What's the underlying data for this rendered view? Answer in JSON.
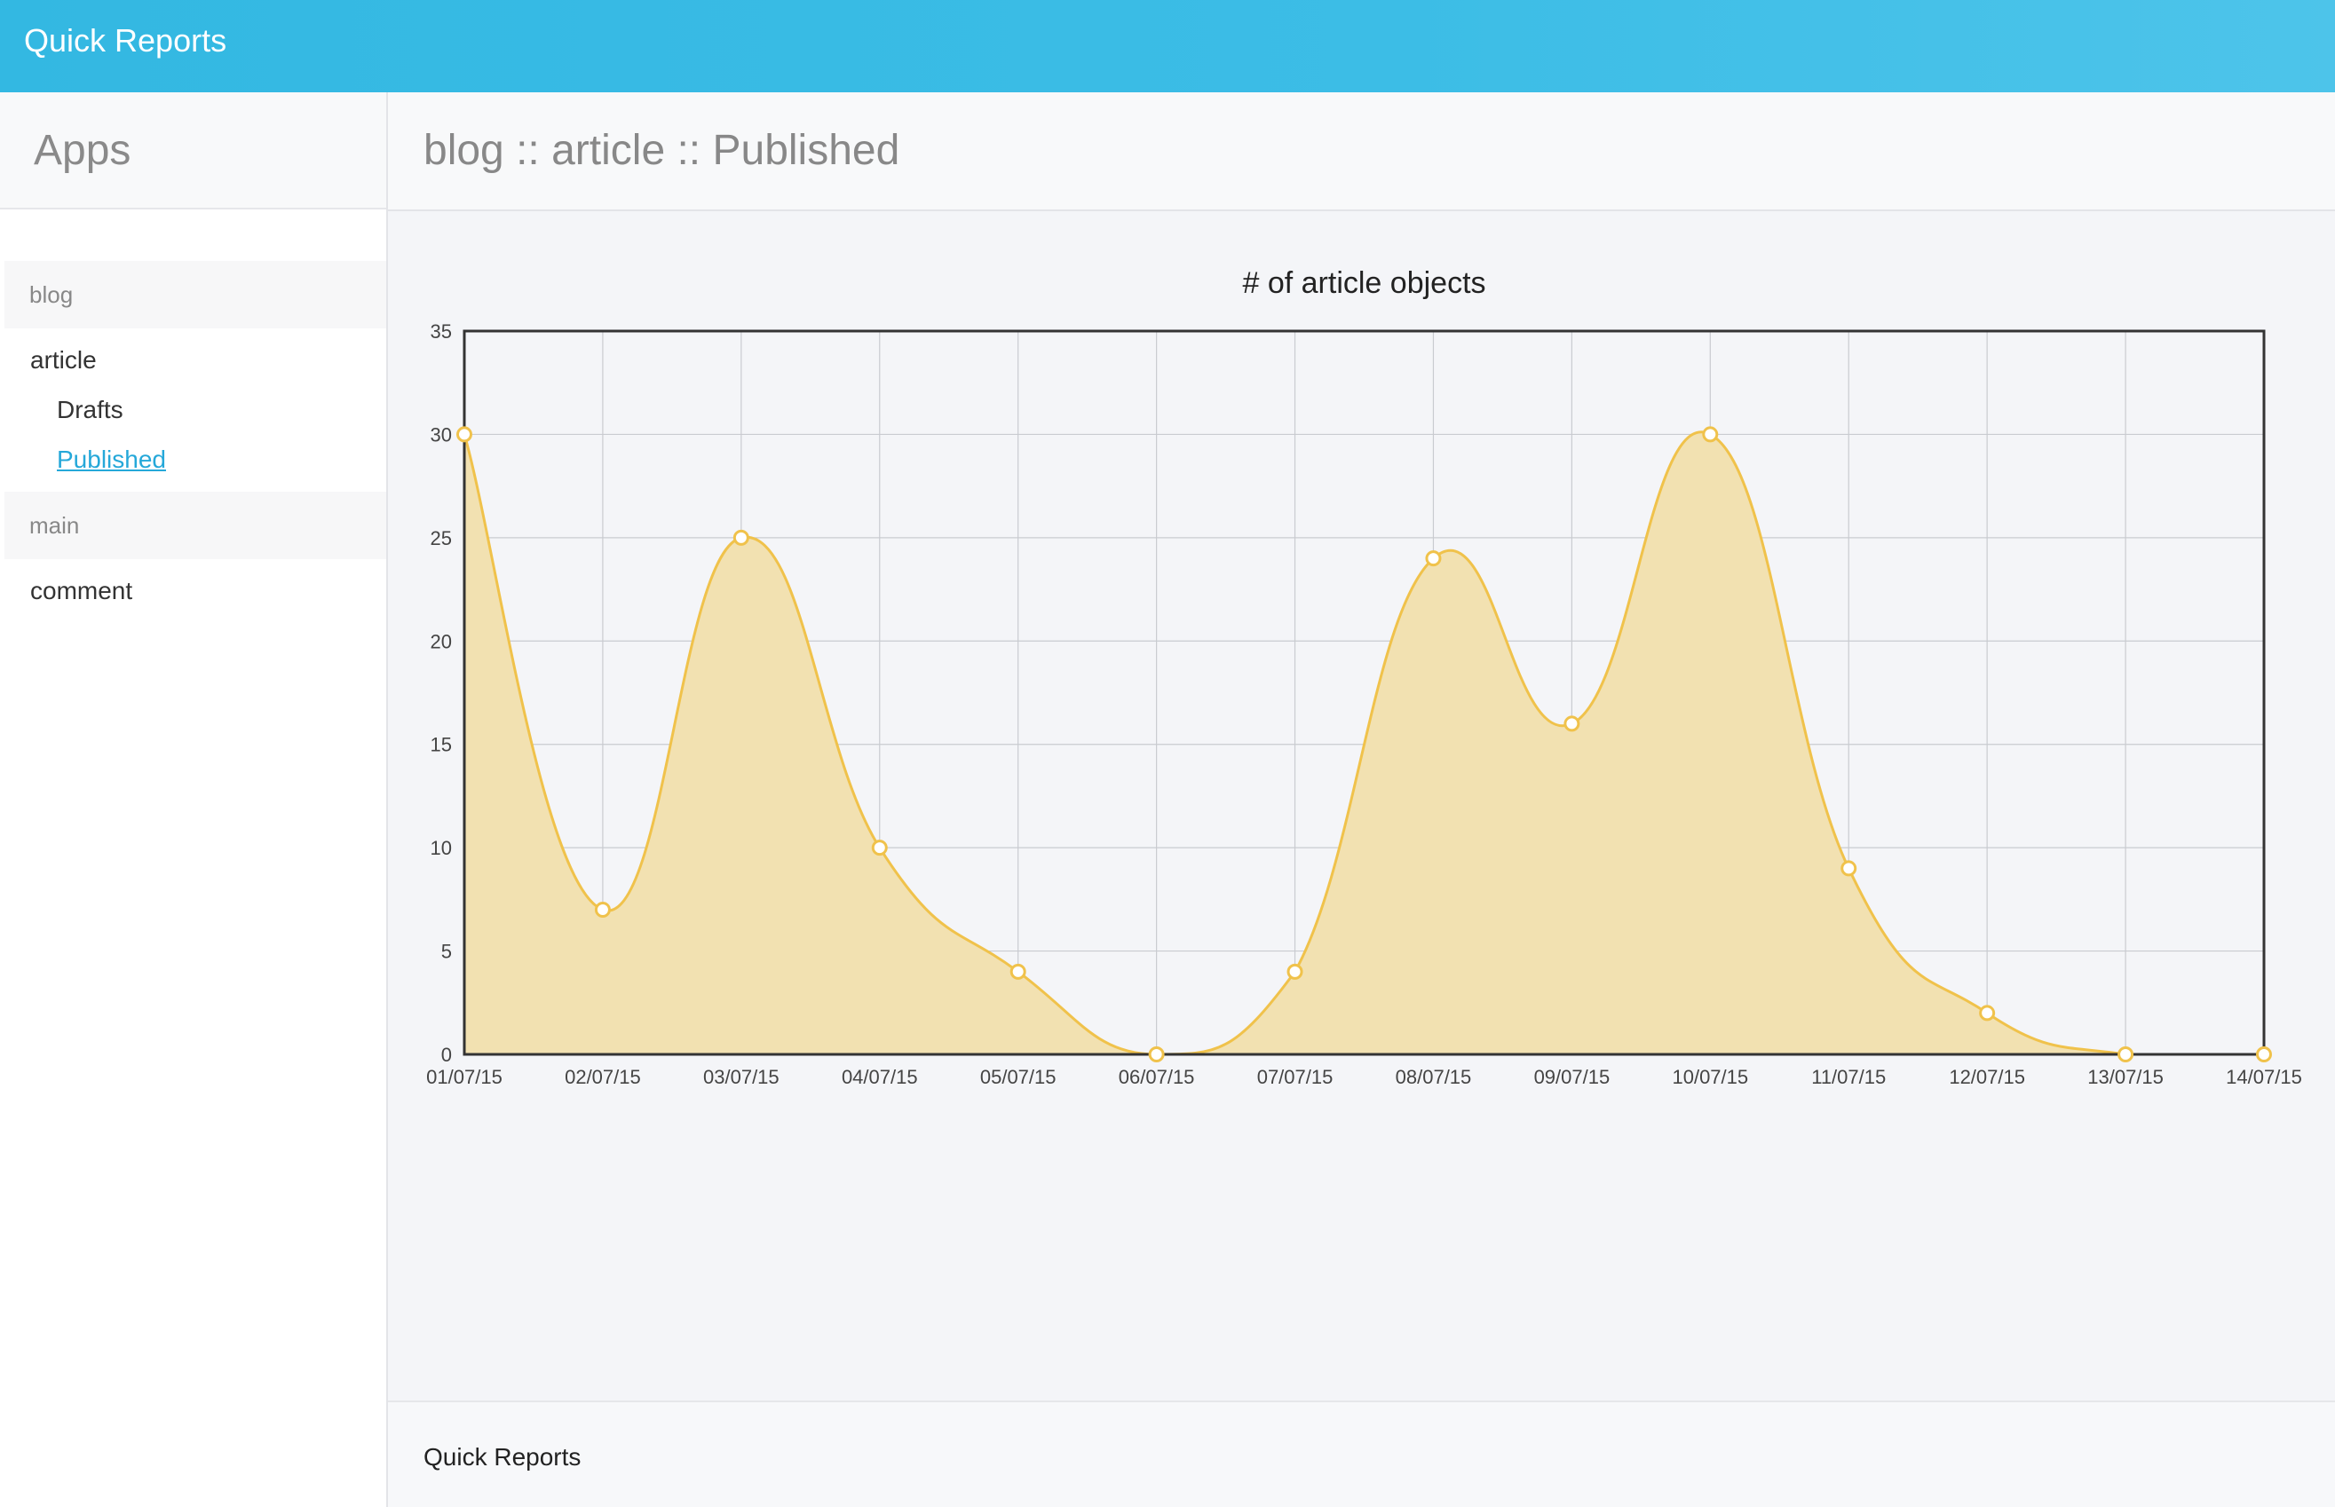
{
  "navbar": {
    "brand": "Quick Reports"
  },
  "sidebar": {
    "title": "Apps",
    "groups": [
      {
        "label": "blog",
        "items": [
          {
            "label": "article"
          },
          {
            "label": "Drafts"
          },
          {
            "label": "Published",
            "active": true
          }
        ]
      },
      {
        "label": "main",
        "items": [
          {
            "label": "comment"
          }
        ]
      }
    ]
  },
  "main": {
    "title": "blog :: article :: Published"
  },
  "footer": {
    "text": "Quick Reports"
  },
  "colors": {
    "navbar": "#3cbde6",
    "link_active": "#25a8d9",
    "series_line": "#f0c24b",
    "series_fill": "#f2e1b1"
  },
  "chart_data": {
    "type": "area",
    "title": "# of article objects",
    "xlabel": "",
    "ylabel": "",
    "categories": [
      "01/07/15",
      "02/07/15",
      "03/07/15",
      "04/07/15",
      "05/07/15",
      "06/07/15",
      "07/07/15",
      "08/07/15",
      "09/07/15",
      "10/07/15",
      "11/07/15",
      "12/07/15",
      "13/07/15",
      "14/07/15"
    ],
    "values": [
      30,
      7,
      25,
      10,
      4,
      0,
      4,
      24,
      16,
      30,
      9,
      2,
      0,
      0
    ],
    "ylim": [
      0,
      35
    ],
    "yticks": [
      0,
      5,
      10,
      15,
      20,
      25,
      30,
      35
    ],
    "grid": true,
    "legend": "none"
  }
}
